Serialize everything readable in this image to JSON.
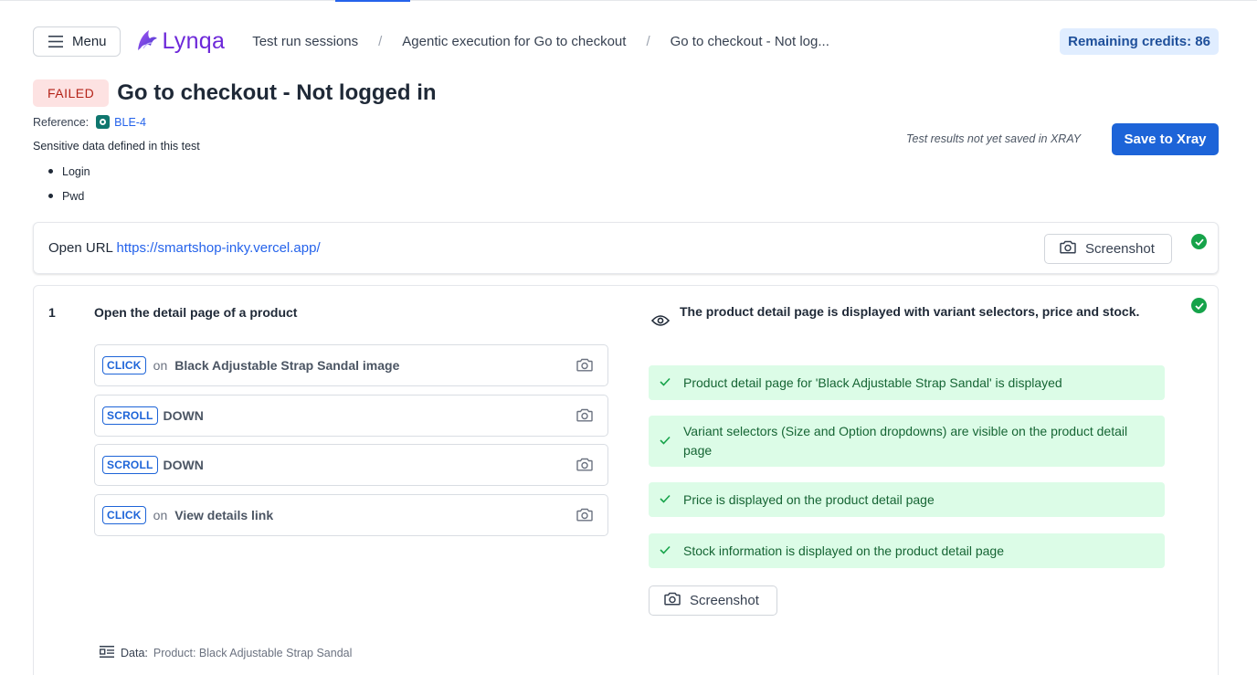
{
  "header": {
    "menu_label": "Menu",
    "logo_text": "Lynqa",
    "breadcrumb": [
      "Test run sessions",
      "Agentic execution for Go to checkout",
      "Go to checkout - Not log..."
    ],
    "breadcrumb_separator": "/",
    "credits": "Remaining credits: 86"
  },
  "test": {
    "status": "FAILED",
    "title": "Go to checkout - Not logged in",
    "reference_label": "Reference:",
    "reference_id": "BLE-4",
    "sensitive_heading": "Sensitive data defined in this test",
    "sensitive_items": [
      "Login",
      "Pwd"
    ],
    "xray_note": "Test results not yet saved in XRAY",
    "save_label": "Save to Xray"
  },
  "open_url": {
    "label": "Open URL",
    "url": "https://smartshop-inky.vercel.app/",
    "screenshot_label": "Screenshot"
  },
  "step": {
    "number": "1",
    "title": "Open the detail page of a product",
    "actions": [
      {
        "type": "CLICK",
        "on": "on",
        "target": "Black Adjustable Strap Sandal image"
      },
      {
        "type": "SCROLL",
        "target": "DOWN"
      },
      {
        "type": "SCROLL",
        "target": "DOWN"
      },
      {
        "type": "CLICK",
        "on": "on",
        "target": "View details link"
      }
    ],
    "expected": "The product detail page is displayed with variant selectors, price and stock.",
    "assertions": [
      "Product detail page for 'Black Adjustable Strap Sandal' is displayed",
      "Variant selectors (Size and Option dropdowns) are visible on the product detail page",
      "Price is displayed on the product detail page",
      "Stock information is displayed on the product detail page"
    ],
    "screenshot_label": "Screenshot",
    "data_label": "Data:",
    "data_value": "Product: Black Adjustable Strap Sandal"
  },
  "colors": {
    "accent": "#1d64d8",
    "failed_bg": "#fde2e2",
    "failed_text": "#b42318",
    "success_bg": "#dcfce7",
    "success_text": "#166534",
    "check_green": "#16a34a",
    "logo": "#6d28d9"
  },
  "icons": {
    "menu": "hamburger-icon",
    "logo": "lynqa-bird-icon",
    "reference": "xray-icon",
    "camera": "camera-icon",
    "status": "check-circle-icon",
    "expected": "eye-icon",
    "assertion": "checkmark-icon",
    "data": "data-list-icon"
  }
}
